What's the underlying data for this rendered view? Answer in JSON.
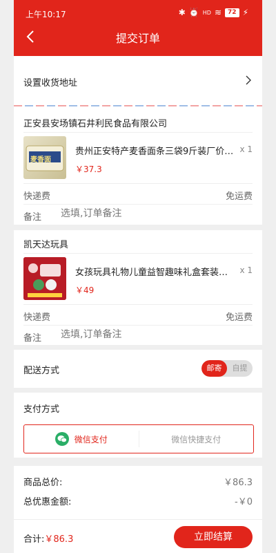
{
  "status_bar": {
    "time": "上午10:17",
    "signal": "HD",
    "battery": "72"
  },
  "nav": {
    "title": "提交订单"
  },
  "address": {
    "label": "设置收货地址"
  },
  "orders": [
    {
      "shop": "正安县安场镇石井利民食品有限公司",
      "product_title": "贵州正安特产麦香面条三袋9斤装厂价…",
      "image_text": "麦香面",
      "qty": "x 1",
      "price": "￥37.3",
      "shipping_label": "快递费",
      "shipping_value": "免运费",
      "remark_label": "备注",
      "remark_placeholder": "选填,订单备注"
    },
    {
      "shop": "凯天达玩具",
      "product_title": "女孩玩具礼物儿童益智趣味礼盒套装…",
      "qty": "x 1",
      "price": "￥49",
      "shipping_label": "快递费",
      "shipping_value": "免运费",
      "remark_label": "备注",
      "remark_placeholder": "选填,订单备注"
    }
  ],
  "delivery": {
    "label": "配送方式",
    "options": [
      "邮寄",
      "自提"
    ],
    "selected": "邮寄"
  },
  "payment": {
    "label": "支付方式",
    "options": [
      "微信支付",
      "微信快捷支付"
    ],
    "selected": "微信支付"
  },
  "summary": {
    "goods_total_label": "商品总价:",
    "goods_total_value": "￥86.3",
    "discount_label": "总优惠金额:",
    "discount_value": "-￥0"
  },
  "footer": {
    "total_label": "合计:",
    "total_value": "￥86.3",
    "checkout_label": "立即结算"
  },
  "colors": {
    "accent": "#e1251b",
    "wechat": "#2aae67"
  }
}
